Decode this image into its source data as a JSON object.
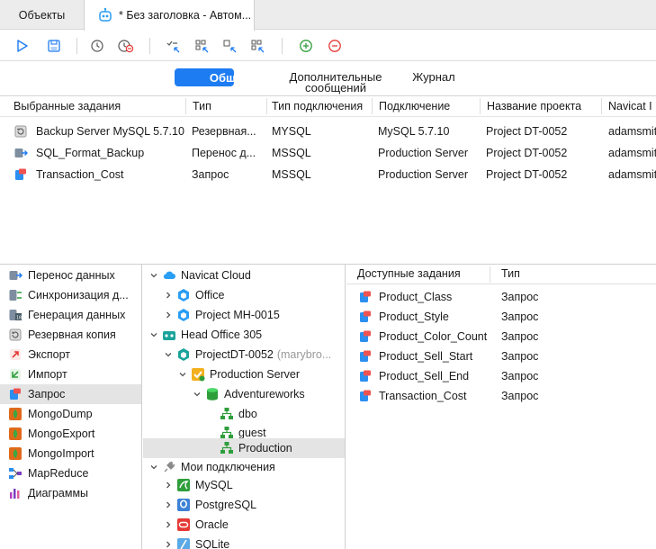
{
  "tabs": {
    "objects": "Объекты",
    "active": "* Без заголовка - Автом..."
  },
  "segments": {
    "general": "Общ",
    "advanced": "Дополнительные сообщений",
    "log": "Журнал"
  },
  "table": {
    "headers": [
      "Выбранные задания",
      "Тип",
      "Тип подключения",
      "Подключение",
      "Название проекта",
      "Navicat I"
    ],
    "rows": [
      {
        "name": "Backup Server MySQL 5.7.10",
        "type": "Резервная...",
        "conn_type": "MYSQL",
        "connection": "MySQL 5.7.10",
        "project": "Project DT-0052",
        "user": "adamsmit"
      },
      {
        "name": "SQL_Format_Backup",
        "type": "Перенос д...",
        "conn_type": "MSSQL",
        "connection": "Production Server",
        "project": "Project DT-0052",
        "user": "adamsmit"
      },
      {
        "name": "Transaction_Cost",
        "type": "Запрос",
        "conn_type": "MSSQL",
        "connection": "Production Server",
        "project": "Project DT-0052",
        "user": "adamsmit"
      }
    ]
  },
  "categories": [
    {
      "label": "Перенос данных",
      "icon": "data-transfer-icon"
    },
    {
      "label": "Синхронизация д...",
      "icon": "data-sync-icon"
    },
    {
      "label": "Генерация данных",
      "icon": "data-generation-icon"
    },
    {
      "label": "Резервная копия",
      "icon": "backup-icon"
    },
    {
      "label": "Экспорт",
      "icon": "export-icon"
    },
    {
      "label": "Импорт",
      "icon": "import-icon"
    },
    {
      "label": "Запрос",
      "icon": "query-icon"
    },
    {
      "label": "MongoDump",
      "icon": "mongodump-icon"
    },
    {
      "label": "MongoExport",
      "icon": "mongoexport-icon"
    },
    {
      "label": "MongoImport",
      "icon": "mongoimport-icon"
    },
    {
      "label": "MapReduce",
      "icon": "mapreduce-icon"
    },
    {
      "label": "Диаграммы",
      "icon": "charts-icon"
    }
  ],
  "tree": {
    "navicat_cloud": "Navicat Cloud",
    "office": "Office",
    "project_mh": "Project MH-0015",
    "head_office": "Head Office 305",
    "project_dt": "ProjectDT-0052",
    "project_dt_owner": "(marybro...",
    "production_server": "Production Server",
    "adventureworks": "Adventureworks",
    "dbo": "dbo",
    "guest": "guest",
    "production": "Production",
    "my_connections": "Мои подключения",
    "mysql": "MySQL",
    "postgresql": "PostgreSQL",
    "oracle": "Oracle",
    "sqlite": "SQLite"
  },
  "available": {
    "headers": [
      "Доступные задания",
      "Тип"
    ],
    "rows": [
      {
        "name": "Product_Class",
        "type": "Запрос"
      },
      {
        "name": "Product_Style",
        "type": "Запрос"
      },
      {
        "name": "Product_Color_Count",
        "type": "Запрос"
      },
      {
        "name": "Product_Sell_Start",
        "type": "Запрос"
      },
      {
        "name": "Product_Sell_End",
        "type": "Запрос"
      },
      {
        "name": "Transaction_Cost",
        "type": "Запрос"
      }
    ]
  },
  "colors": {
    "accent": "#1e7cf2",
    "selection": "#e4e4e4"
  }
}
